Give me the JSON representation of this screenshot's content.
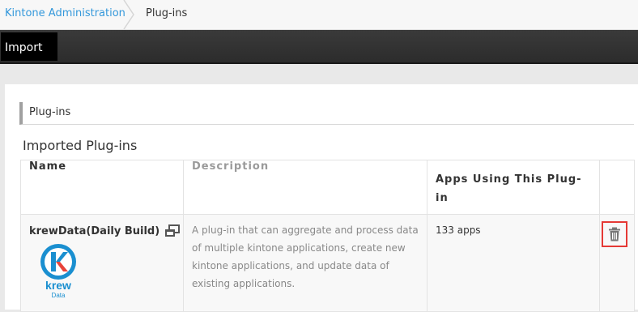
{
  "breadcrumb": {
    "home": "Kintone Administration",
    "current": "Plug-ins"
  },
  "toolbar": {
    "import_label": "Import"
  },
  "section": {
    "header": "Plug-ins",
    "subtitle": "Imported Plug-ins"
  },
  "table": {
    "columns": [
      "Name",
      "Description",
      "Apps Using This Plug-in",
      ""
    ],
    "rows": [
      {
        "name": "krewData(Daily Build)",
        "description": "A plug-in that can aggregate and process data of multiple kintone applications, create new kintone applications, and update data of existing applications.",
        "apps": "133 apps",
        "logo_text": "krew",
        "logo_sub": "Data",
        "icons": [
          "open-window-icon",
          "trash-icon"
        ]
      }
    ]
  },
  "colors": {
    "link": "#3498db",
    "toolbar": "#2f2f2f",
    "delete_highlight": "#e53935",
    "logo_blue": "#1a8fd0"
  }
}
